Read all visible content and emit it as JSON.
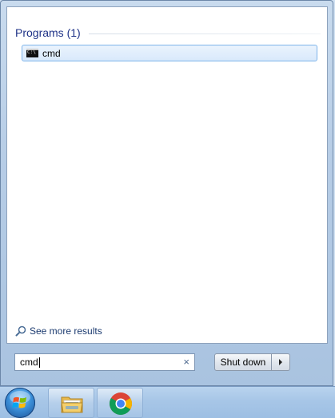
{
  "results": {
    "header": "Programs (1)",
    "items": [
      {
        "label": "cmd",
        "icon": "command-prompt-icon"
      }
    ]
  },
  "see_more": {
    "label": "See more results",
    "icon": "search-icon"
  },
  "search": {
    "value": "cmd",
    "clear_icon": "×"
  },
  "shutdown": {
    "label": "Shut down",
    "arrow_icon": "arrow-right-icon"
  },
  "taskbar": {
    "items": [
      {
        "icon": "windows-start-orb-icon"
      },
      {
        "icon": "windows-explorer-folder-icon"
      },
      {
        "icon": "google-chrome-icon"
      }
    ]
  },
  "colors": {
    "header_text": "#1e3287",
    "selected_item_border": "#7eb4ea",
    "taskbar": "#a7c6e7"
  }
}
